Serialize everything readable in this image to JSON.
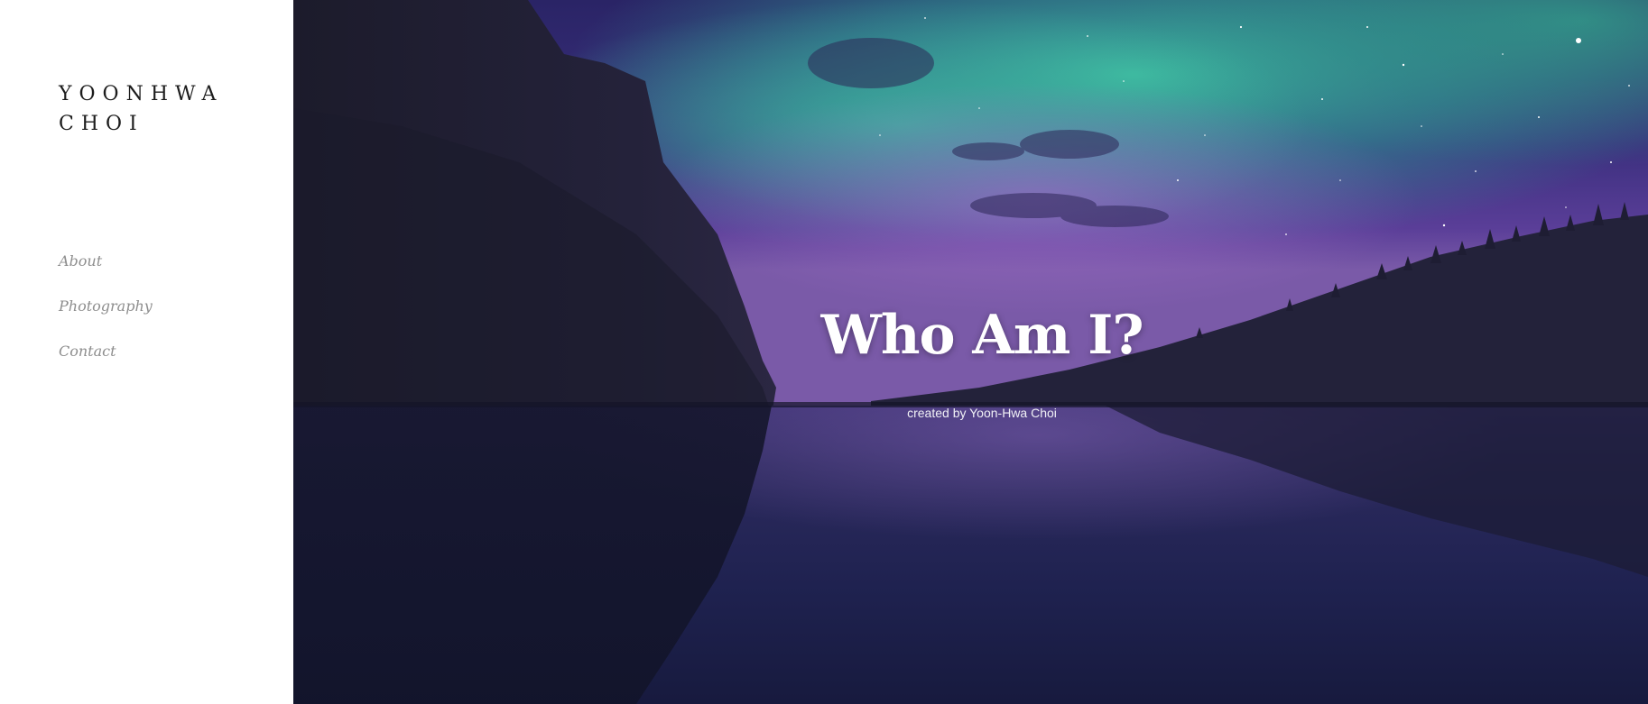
{
  "sidebar": {
    "brand_line_1": "YOONHWA",
    "brand_line_2": "CHOI",
    "nav": [
      {
        "label": "About"
      },
      {
        "label": "Photography"
      },
      {
        "label": "Contact"
      }
    ]
  },
  "hero": {
    "title": "Who Am I?",
    "subtitle": "created by Yoon-Hwa Choi",
    "background_image": "aurora-night-lake-photo"
  },
  "colors": {
    "sidebar_bg": "#ffffff",
    "brand_text": "#1c1c1c",
    "nav_text": "#8e8e8e",
    "hero_title": "#ffffff",
    "sky_teal": "#39b59a",
    "sky_purple": "#6a3fa8",
    "water_dark": "#1a1a3a"
  }
}
